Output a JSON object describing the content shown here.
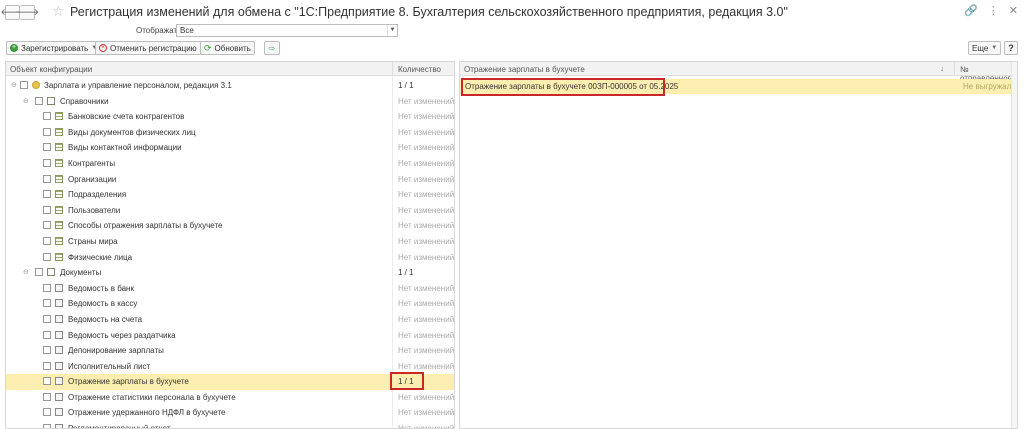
{
  "window": {
    "title": "Регистрация изменений для обмена с  \"1С:Предприятие 8. Бухгалтерия сельскохозяйственного предприятия, редакция 3.0\""
  },
  "filter": {
    "label": "Отображать:",
    "value": "Все"
  },
  "toolbar": {
    "register_label": "Зарегистрировать",
    "cancel_label": "Отменить регистрацию",
    "refresh_label": "Обновить",
    "more_label": "Еще",
    "help_label": "?"
  },
  "left_grid": {
    "col_object": "Объект конфигурации",
    "col_count": "Количество",
    "rows": [
      {
        "label": "Зарплата и управление персоналом, редакция 3.1",
        "count": "1 / 1",
        "level": 0,
        "type": "conf",
        "expander": "⊖"
      },
      {
        "label": "Справочники",
        "count": "Нет изменений",
        "level": 1,
        "type": "folder",
        "expander": "⊖"
      },
      {
        "label": "Банковские счета контрагентов",
        "count": "Нет изменений",
        "level": 2,
        "type": "tbl"
      },
      {
        "label": "Виды документов физических лиц",
        "count": "Нет изменений",
        "level": 2,
        "type": "tbl"
      },
      {
        "label": "Виды контактной информации",
        "count": "Нет изменений",
        "level": 2,
        "type": "tbl"
      },
      {
        "label": "Контрагенты",
        "count": "Нет изменений",
        "level": 2,
        "type": "tbl"
      },
      {
        "label": "Организации",
        "count": "Нет изменений",
        "level": 2,
        "type": "tbl"
      },
      {
        "label": "Подразделения",
        "count": "Нет изменений",
        "level": 2,
        "type": "tbl"
      },
      {
        "label": "Пользователи",
        "count": "Нет изменений",
        "level": 2,
        "type": "tbl"
      },
      {
        "label": "Способы отражения зарплаты в бухучете",
        "count": "Нет изменений",
        "level": 2,
        "type": "tbl"
      },
      {
        "label": "Страны мира",
        "count": "Нет изменений",
        "level": 2,
        "type": "tbl"
      },
      {
        "label": "Физические лица",
        "count": "Нет изменений",
        "level": 2,
        "type": "tbl"
      },
      {
        "label": "Документы",
        "count": "1 / 1",
        "level": 1,
        "type": "folder",
        "expander": "⊖"
      },
      {
        "label": "Ведомость в банк",
        "count": "Нет изменений",
        "level": 2,
        "type": "doc"
      },
      {
        "label": "Ведомость в кассу",
        "count": "Нет изменений",
        "level": 2,
        "type": "doc"
      },
      {
        "label": "Ведомость на счета",
        "count": "Нет изменений",
        "level": 2,
        "type": "doc"
      },
      {
        "label": "Ведомость через раздатчика",
        "count": "Нет изменений",
        "level": 2,
        "type": "doc"
      },
      {
        "label": "Депонирование зарплаты",
        "count": "Нет изменений",
        "level": 2,
        "type": "doc"
      },
      {
        "label": "Исполнительный лист",
        "count": "Нет изменений",
        "level": 2,
        "type": "doc"
      },
      {
        "label": "Отражение зарплаты в бухучете",
        "count": "1 / 1",
        "level": 2,
        "type": "doc",
        "selected": true
      },
      {
        "label": "Отражение статистики персонала в бухучете",
        "count": "Нет изменений",
        "level": 2,
        "type": "doc"
      },
      {
        "label": "Отражение удержанного НДФЛ в бухучете",
        "count": "Нет изменений",
        "level": 2,
        "type": "doc"
      },
      {
        "label": "Регламентированный отчет",
        "count": "Нет изменений",
        "level": 2,
        "type": "doc"
      }
    ]
  },
  "right_grid": {
    "col_object": "Отражение зарплаты в бухучете",
    "sort_arrow": "↓",
    "col_number": "№ отправленного",
    "rows": [
      {
        "label": "Отражение зарплаты в бухучете 00ЗП-000005 от     05.2025",
        "status": "Не выгружалось"
      }
    ]
  }
}
